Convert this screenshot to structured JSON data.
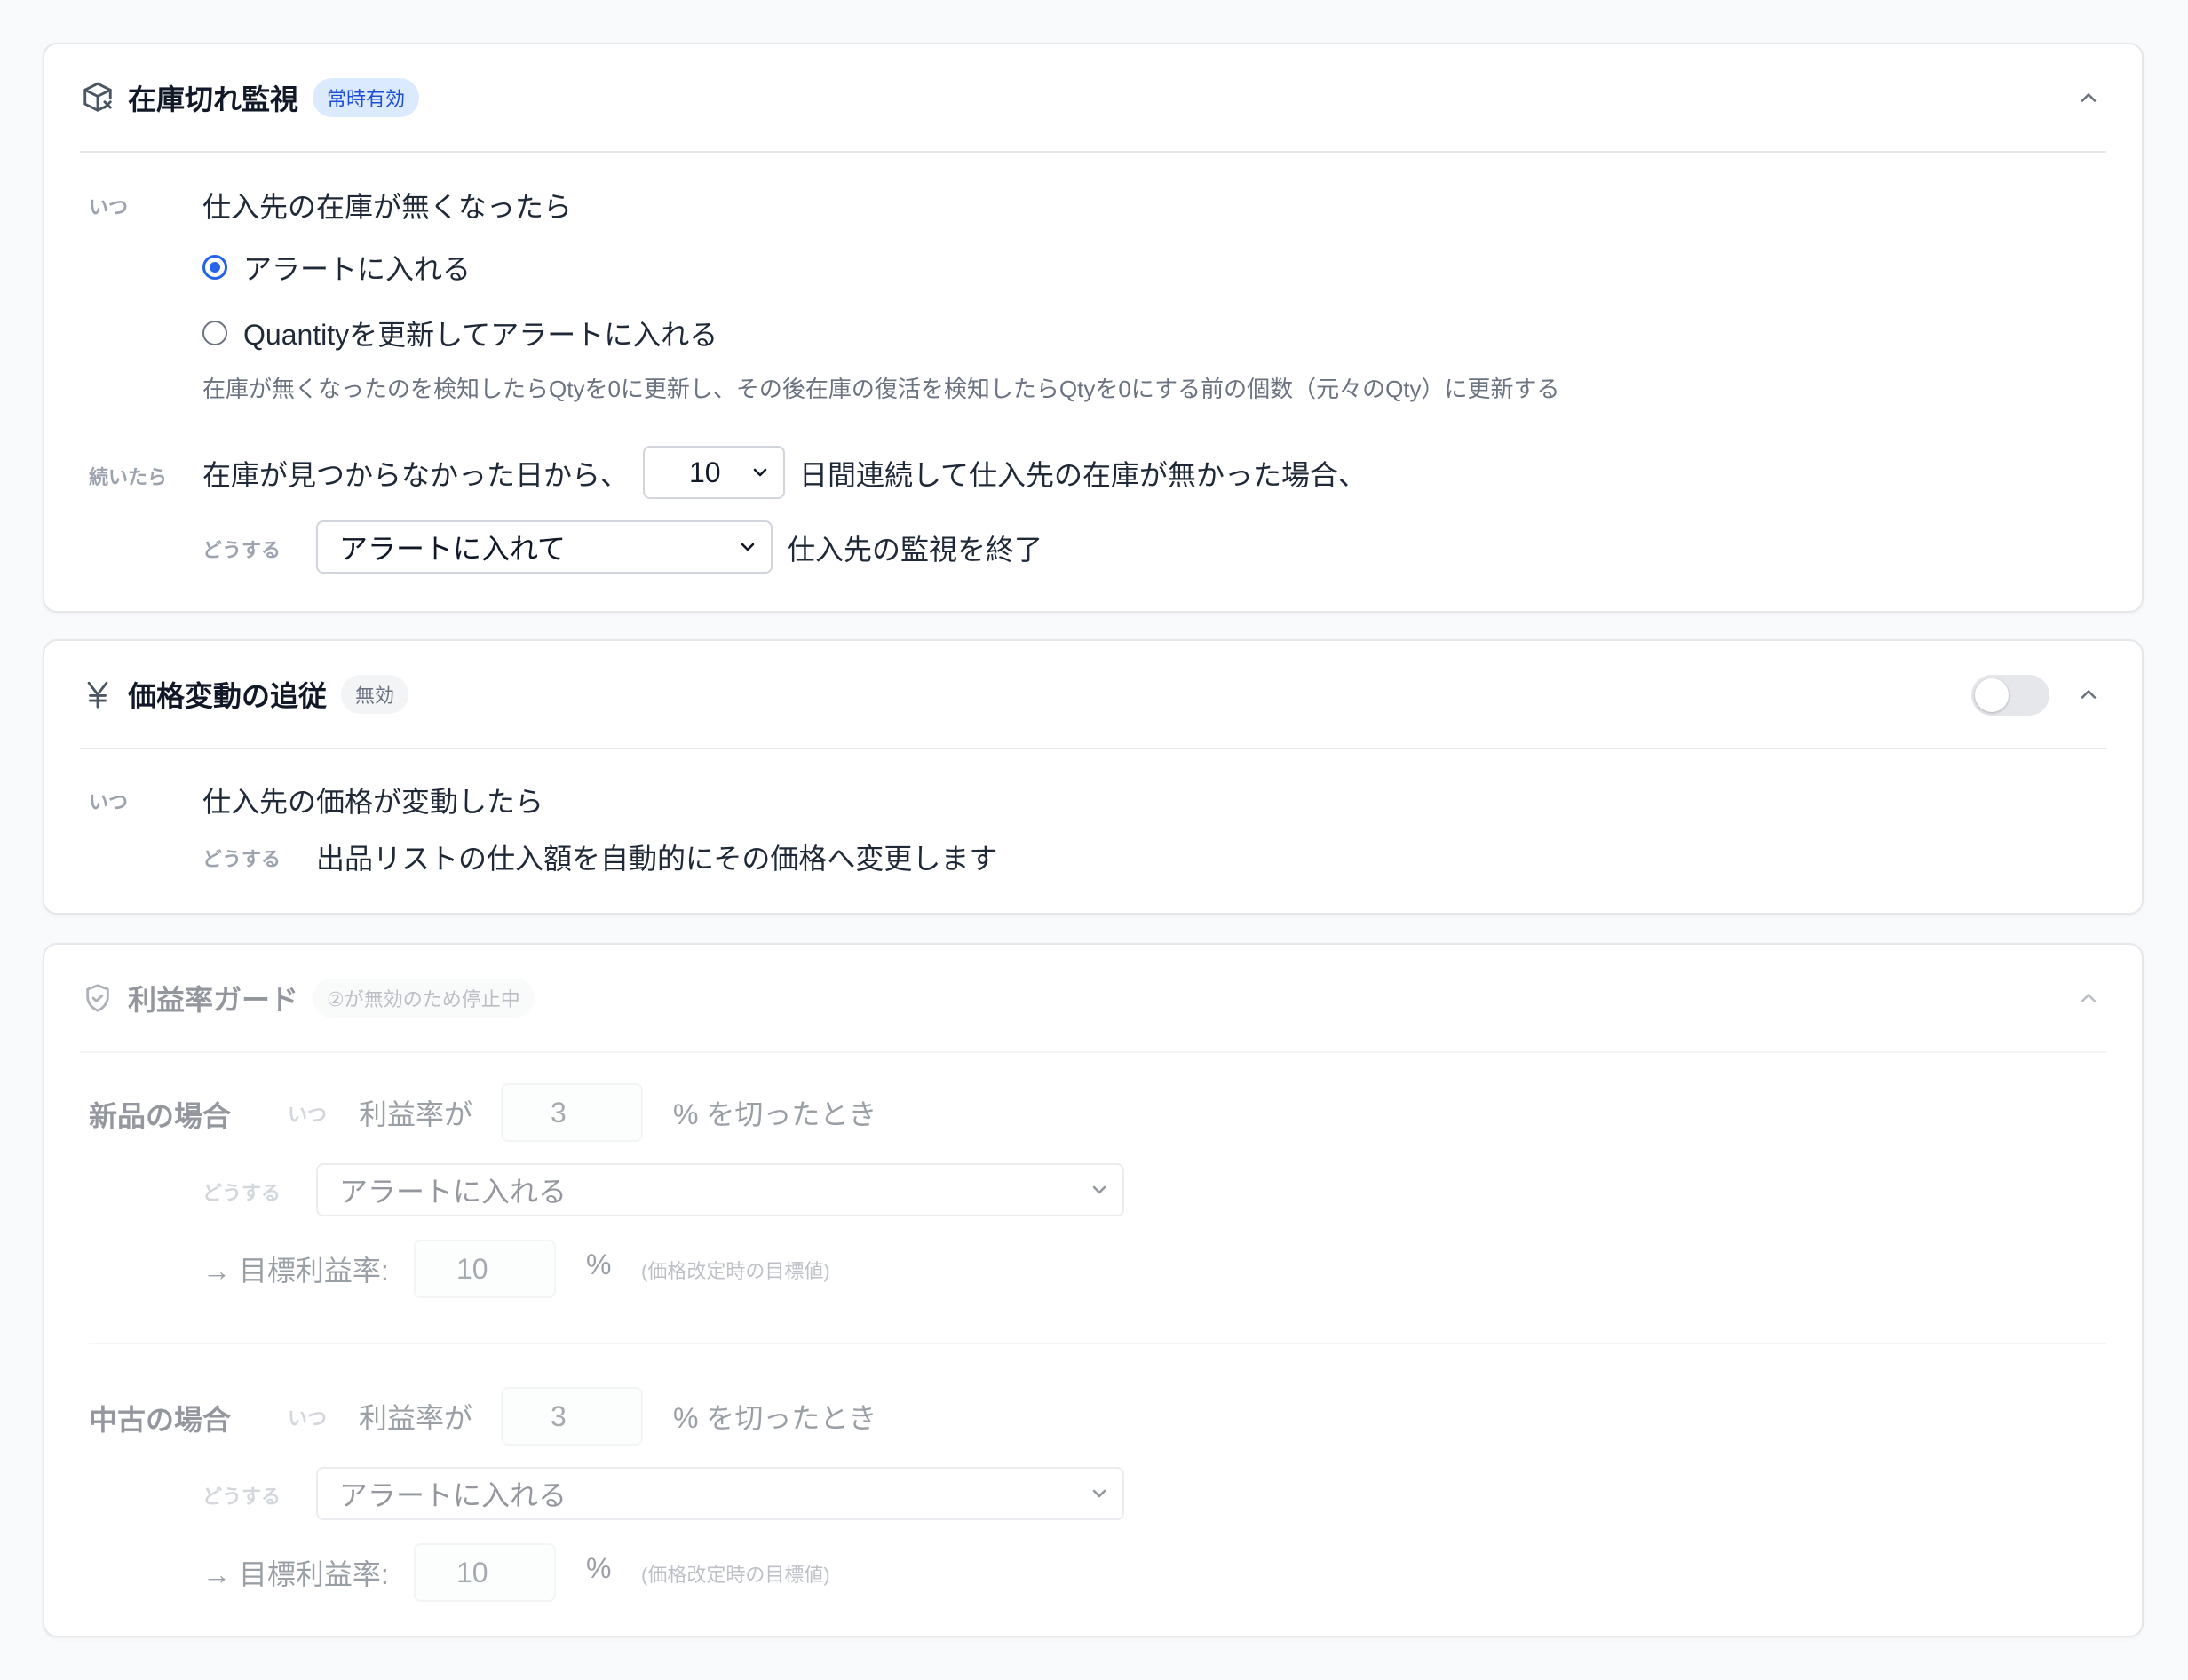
{
  "stock_section": {
    "title": "在庫切れ監視",
    "badge": "常時有効",
    "when_label": "いつ",
    "when_text": "仕入先の在庫が無くなったら",
    "options": [
      "アラートに入れる",
      "Quantityを更新してアラートに入れる"
    ],
    "selected_option": 0,
    "description": "在庫が無くなったのを検知したらQtyを0に更新し、その後在庫の復活を検知したらQtyを0にする前の個数（元々のQty）に更新する",
    "continue_label": "続いたら",
    "continue_prefix": "在庫が見つからなかった日から、",
    "days_value": "10",
    "continue_suffix": "日間連続して仕入先の在庫が無かった場合、",
    "action_label": "どうする",
    "action_value": "アラートに入れて",
    "action_suffix": "仕入先の監視を終了"
  },
  "price_section": {
    "title": "価格変動の追従",
    "badge": "無効",
    "enabled": false,
    "when_label": "いつ",
    "when_text": "仕入先の価格が変動したら",
    "action_label": "どうする",
    "action_text": "出品リストの仕入額を自動的にその価格へ変更します"
  },
  "margin_section": {
    "title": "利益率ガード",
    "badge": "②が無効のため停止中",
    "new": {
      "heading": "新品の場合",
      "when_label": "いつ",
      "prefix": "利益率が",
      "threshold": "3",
      "suffix": "% を切ったとき",
      "action_label": "どうする",
      "action_value": "アラートに入れる",
      "target_label": "→ 目標利益率:",
      "target_value": "10",
      "percent": "%",
      "note": "(価格改定時の目標値)"
    },
    "used": {
      "heading": "中古の場合",
      "when_label": "いつ",
      "prefix": "利益率が",
      "threshold": "3",
      "suffix": "% を切ったとき",
      "action_label": "どうする",
      "action_value": "アラートに入れる",
      "target_label": "→ 目標利益率:",
      "target_value": "10",
      "percent": "%",
      "note": "(価格改定時の目標値)"
    }
  },
  "icons": {
    "stock": "box-x-icon",
    "price": "yen-icon",
    "margin": "shield-check-icon",
    "collapse": "chevron-up-icon",
    "select": "chevron-down-icon"
  },
  "colors": {
    "accent": "#2563eb",
    "badge_active_bg": "#dbeafe",
    "badge_active_text": "#1d4ed8",
    "border": "#e5e7eb"
  }
}
